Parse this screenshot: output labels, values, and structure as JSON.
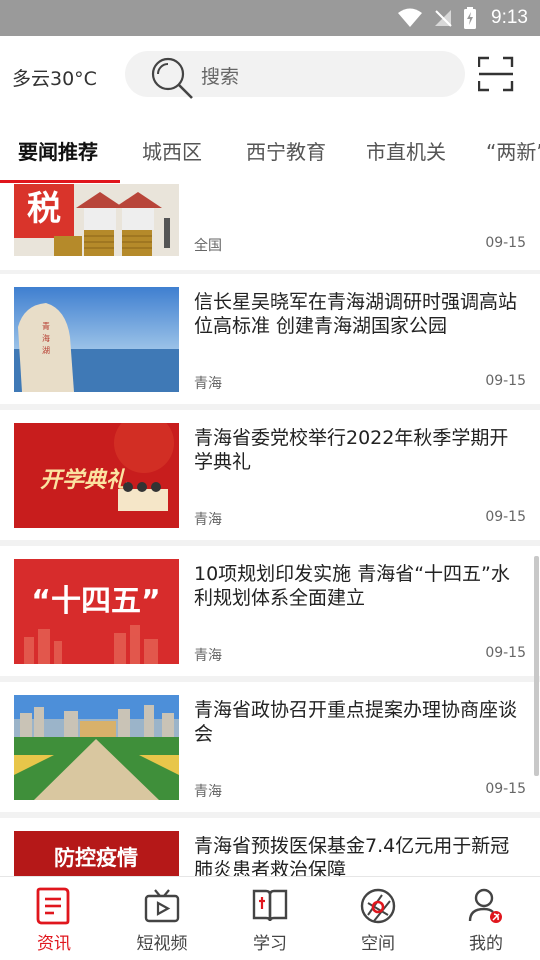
{
  "status_bar": {
    "time": "9:13"
  },
  "header": {
    "weather": "多云30°C",
    "search_placeholder": "搜索"
  },
  "tabs": [
    {
      "label": "要闻推荐",
      "active": true
    },
    {
      "label": "城西区"
    },
    {
      "label": "西宁教育"
    },
    {
      "label": "市直机关"
    },
    {
      "label": "“两新”"
    }
  ],
  "feed": [
    {
      "title": "",
      "source": "全国",
      "date": "09-15",
      "image": "tax-coins"
    },
    {
      "title": "信长星吴晓军在青海湖调研时强调高站位高标准 创建青海湖国家公园",
      "source": "青海",
      "date": "09-15",
      "image": "qinghai-lake-stone"
    },
    {
      "title": "青海省委党校举行2022年秋季学期开学典礼",
      "source": "青海",
      "date": "09-15",
      "image": "opening-ceremony",
      "image_text": "开学典礼"
    },
    {
      "title": "10项规划印发实施 青海省“十四五”水利规划体系全面建立",
      "source": "青海",
      "date": "09-15",
      "image": "fourteenth-five",
      "image_text": "“十四五”"
    },
    {
      "title": "青海省政协召开重点提案办理协商座谈会",
      "source": "青海",
      "date": "09-15",
      "image": "city-square"
    },
    {
      "title": "青海省预拨医保基金7.4亿元用于新冠肺炎患者救治保障",
      "source": "",
      "date": "",
      "image": "epidemic-control",
      "image_text": "防控疫情"
    }
  ],
  "bottom_nav": [
    {
      "label": "资讯",
      "icon": "news-icon",
      "active": true
    },
    {
      "label": "短视频",
      "icon": "tv-icon"
    },
    {
      "label": "学习",
      "icon": "book-icon"
    },
    {
      "label": "空间",
      "icon": "aperture-icon"
    },
    {
      "label": "我的",
      "icon": "profile-icon"
    }
  ],
  "colors": {
    "accent": "#e0161d",
    "statusbar": "#9a9a9a"
  }
}
